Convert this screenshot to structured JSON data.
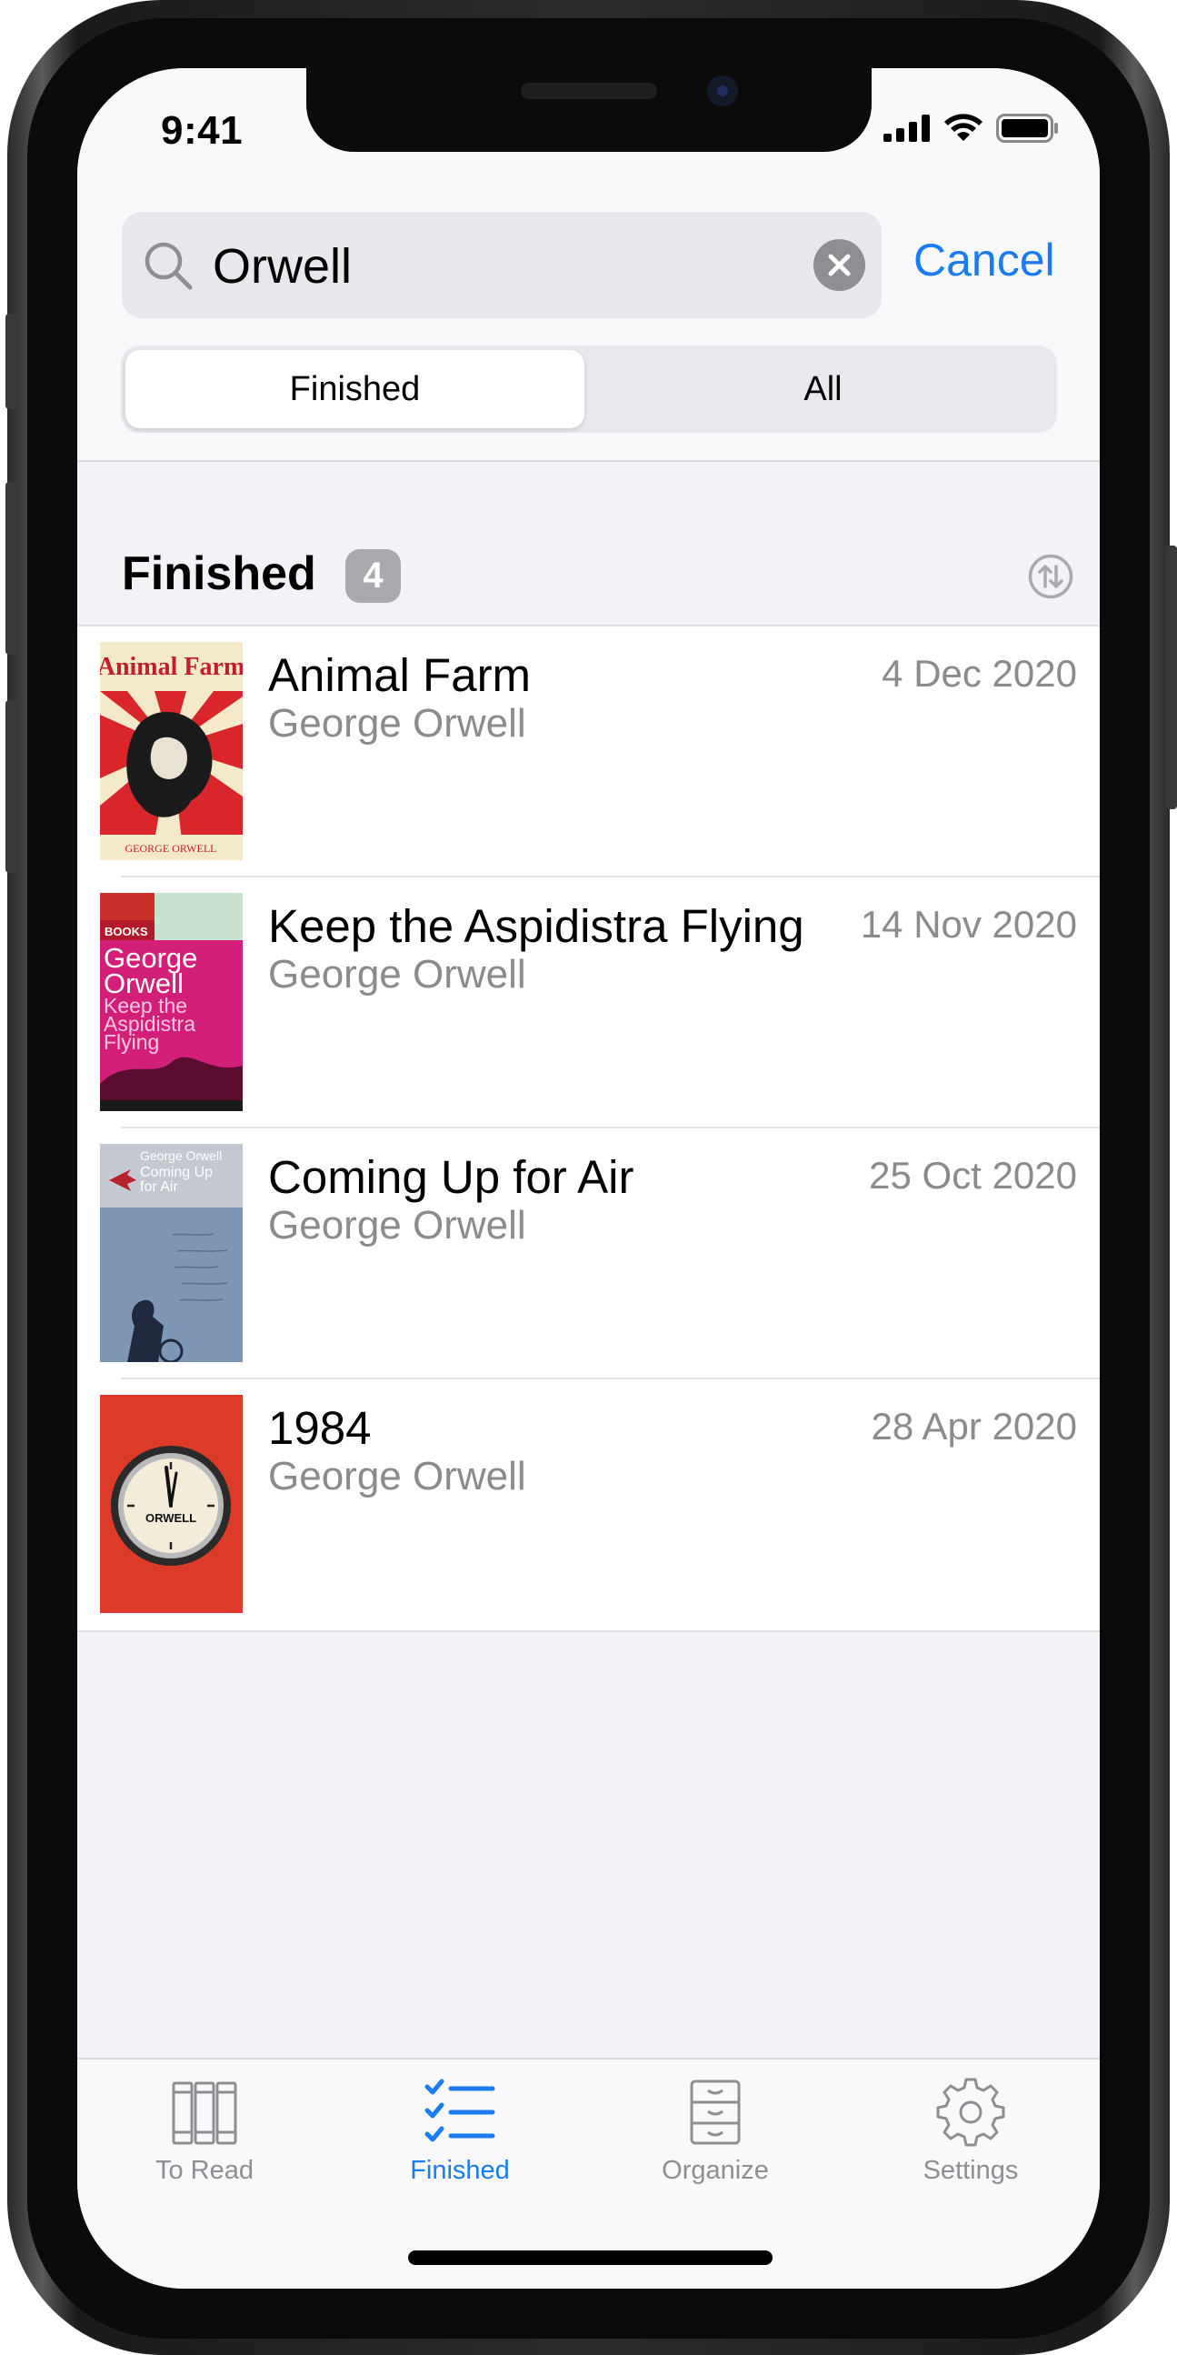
{
  "status_bar": {
    "time": "9:41"
  },
  "search": {
    "query": "Orwell",
    "cancel_label": "Cancel"
  },
  "segments": [
    {
      "label": "Finished",
      "selected": true
    },
    {
      "label": "All",
      "selected": false
    }
  ],
  "section": {
    "title": "Finished",
    "count": "4"
  },
  "books": [
    {
      "title": "Animal Farm",
      "author": "George Orwell",
      "date": "4 Dec 2020"
    },
    {
      "title": "Keep the Aspidistra Flying",
      "author": "George Orwell",
      "date": "14 Nov 2020"
    },
    {
      "title": "Coming Up for Air",
      "author": "George Orwell",
      "date": "25 Oct 2020"
    },
    {
      "title": "1984",
      "author": "George Orwell",
      "date": "28 Apr 2020"
    }
  ],
  "covers": {
    "animal_farm": {
      "title": "Animal Farm",
      "author": "GEORGE ORWELL"
    },
    "aspidistra": {
      "top": "BOOKS",
      "author_line1": "George",
      "author_line2": "Orwell",
      "title_line1": "Keep the",
      "title_line2": "Aspidistra",
      "title_line3": "Flying"
    },
    "coming_up": {
      "author": "George Orwell",
      "title_line1": "Coming Up",
      "title_line2": "for Air"
    },
    "nineteen84": {
      "brand": "ORWELL"
    }
  },
  "tabs": [
    {
      "label": "To Read",
      "icon": "books-icon",
      "active": false
    },
    {
      "label": "Finished",
      "icon": "checklist-icon",
      "active": true
    },
    {
      "label": "Organize",
      "icon": "cabinet-icon",
      "active": false
    },
    {
      "label": "Settings",
      "icon": "gear-icon",
      "active": false
    }
  ],
  "colors": {
    "accent": "#1a7cf0",
    "secondary_text": "#8a8a8f",
    "badge": "#a9a9ae"
  }
}
